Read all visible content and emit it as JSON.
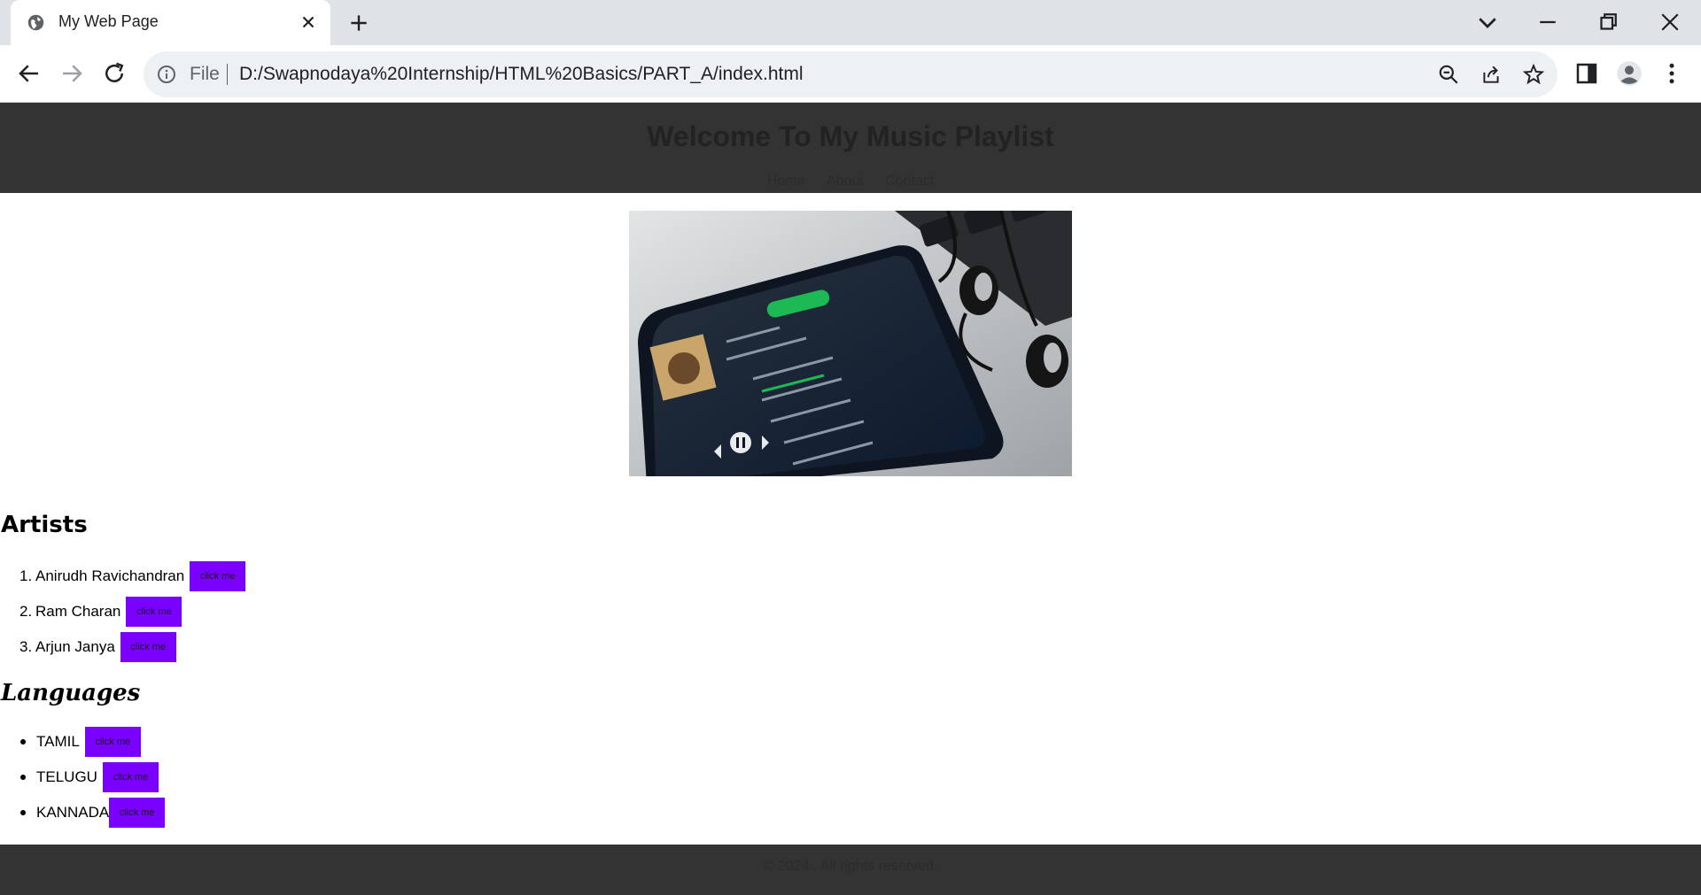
{
  "browser": {
    "tab_title": "My Web Page",
    "omnibox": {
      "scheme_label": "File",
      "url": "D:/Swapnodaya%20Internship/HTML%20Basics/PART_A/index.html"
    }
  },
  "site": {
    "title": "Welcome To My Music Playlist",
    "nav": [
      "Home",
      "About",
      "Contact"
    ],
    "artists_heading": "Artists",
    "artists": [
      {
        "marker": "1.",
        "name": "Anirudh Ravichandran",
        "button": "click me"
      },
      {
        "marker": "2.",
        "name": "Ram Charan",
        "button": "click me"
      },
      {
        "marker": "3.",
        "name": "Arjun Janya",
        "button": "click me"
      }
    ],
    "languages_heading": "Languages",
    "languages": [
      {
        "name": "TAMIL",
        "button": "click me"
      },
      {
        "name": "TELUGU",
        "button": "click me"
      },
      {
        "name": "KANNADA",
        "button": "click me"
      }
    ],
    "footer": "© 2024 . All rights reserved."
  },
  "colors": {
    "header_bg": "#333333",
    "button_bg": "#7a00ff",
    "tabbar_bg": "#dfe3e8"
  },
  "icons": [
    "globe-icon",
    "close-icon",
    "plus-icon",
    "chevron-down-icon",
    "minimize-icon",
    "restore-icon",
    "window-close-icon",
    "back-icon",
    "forward-icon",
    "reload-icon",
    "info-icon",
    "zoom-out-icon",
    "share-icon",
    "star-icon",
    "side-panel-icon",
    "profile-icon",
    "menu-icon"
  ]
}
